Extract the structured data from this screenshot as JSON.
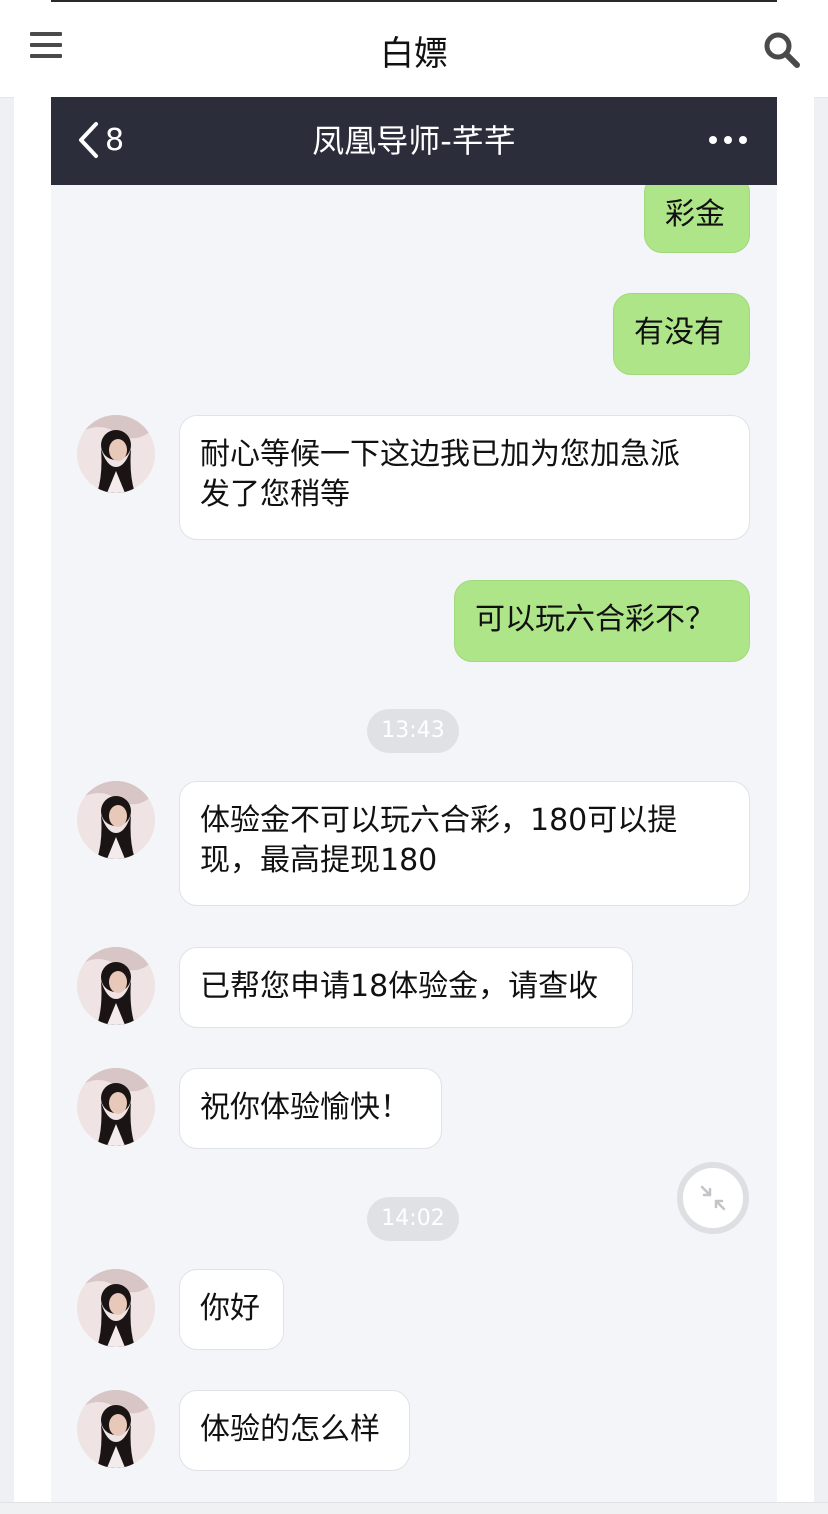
{
  "site": {
    "title": "白嫖"
  },
  "chat": {
    "back_count": "8",
    "title": "凤凰导师-芊芊"
  },
  "messages": {
    "m1": "彩金",
    "m2": "有没有",
    "m3": "耐心等候一下这边我已加为您加急派\n发了您稍等",
    "m4": "可以玩六合彩不？",
    "t1": "13:43",
    "m5": "体验金不可以玩六合彩，180可以提\n现，最高提现180",
    "m6": "已帮您申请18体验金，请查收",
    "m7": "祝你体验愉快！",
    "t2": "14:02",
    "m8": "你好",
    "m9": "体验的怎么样"
  },
  "colors": {
    "header_bg": "#2b2d3b",
    "outgoing_bubble": "#aee588",
    "incoming_bubble": "#ffffff",
    "chat_bg": "#f4f5f8"
  },
  "icons": [
    "menu-icon",
    "search-icon",
    "back-chevron-icon",
    "more-icon",
    "collapse-icon"
  ]
}
